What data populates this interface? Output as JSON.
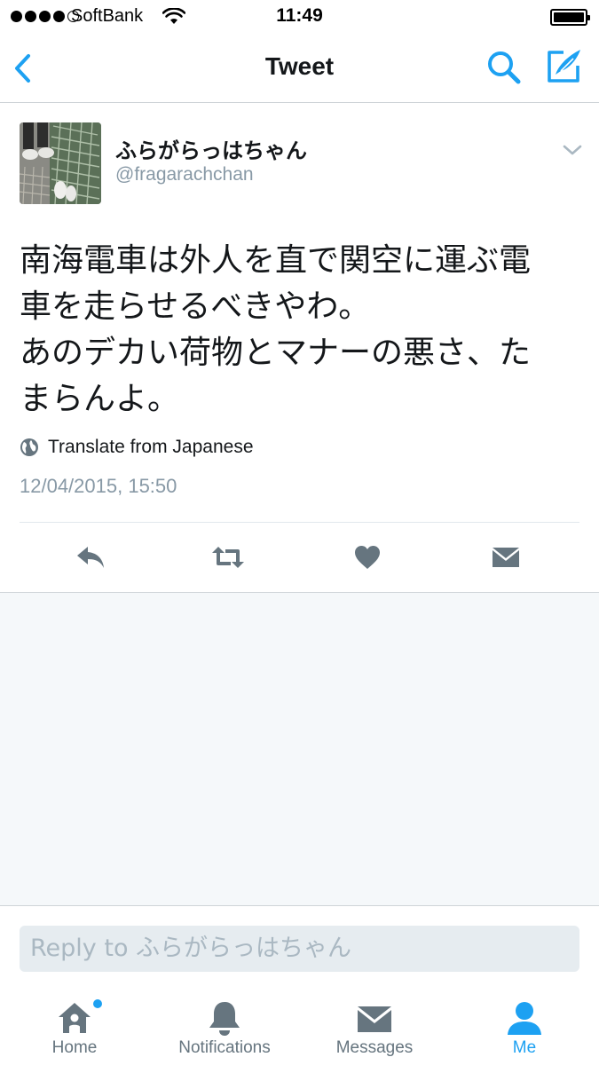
{
  "status_bar": {
    "carrier": "SoftBank",
    "time": "11:49",
    "signal_bars_filled": 4,
    "signal_bars_total": 5,
    "battery_level": 1.0
  },
  "nav": {
    "title": "Tweet",
    "back_icon": "chevron-left-icon",
    "search_icon": "search-icon",
    "compose_icon": "compose-icon"
  },
  "tweet": {
    "display_name": "ふらがらっはちゃん",
    "handle": "@fragarachchan",
    "text_lines": [
      "南海電車は外人を直で関空に運ぶ電",
      "車を走らせるべきやわ。",
      "あのデカい荷物とマナーの悪さ、た",
      "まらんよ。"
    ],
    "translate_label": "Translate from Japanese",
    "timestamp": "12/04/2015, 15:50",
    "actions": [
      "reply-icon",
      "retweet-icon",
      "like-icon",
      "direct-message-icon"
    ]
  },
  "reply": {
    "placeholder": "Reply to ふらがらっはちゃん"
  },
  "tabs": [
    {
      "label": "Home",
      "icon": "home-icon",
      "active": false,
      "badge": true
    },
    {
      "label": "Notifications",
      "icon": "bell-icon",
      "active": false,
      "badge": false
    },
    {
      "label": "Messages",
      "icon": "envelope-icon",
      "active": false,
      "badge": false
    },
    {
      "label": "Me",
      "icon": "person-icon",
      "active": true,
      "badge": false
    }
  ],
  "colors": {
    "accent": "#1da1f2",
    "text_primary": "#14171a",
    "text_secondary": "#8899a6",
    "icon_gray": "#66757f",
    "background_gray": "#f5f8fa"
  }
}
